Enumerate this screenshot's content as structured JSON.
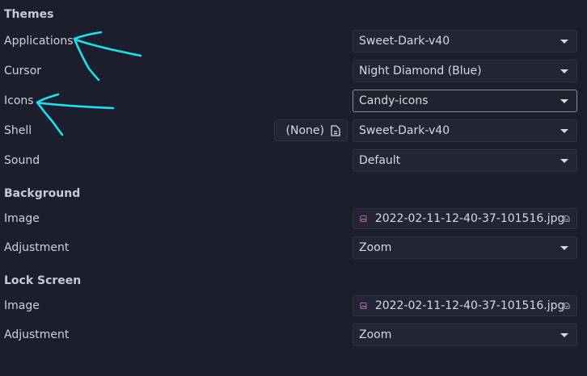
{
  "themes": {
    "title": "Themes",
    "applications": {
      "label": "Applications",
      "value": "Sweet-Dark-v40"
    },
    "cursor": {
      "label": "Cursor",
      "value": "Night Diamond (Blue)"
    },
    "icons": {
      "label": "Icons",
      "value": "Candy-icons"
    },
    "shell": {
      "label": "Shell",
      "value": "Sweet-Dark-v40",
      "file_button": "(None)"
    },
    "sound": {
      "label": "Sound",
      "value": "Default"
    }
  },
  "background": {
    "title": "Background",
    "image": {
      "label": "Image",
      "value": "2022-02-11-12-40-37-101516.jpg"
    },
    "adjustment": {
      "label": "Adjustment",
      "value": "Zoom"
    }
  },
  "lock_screen": {
    "title": "Lock Screen",
    "image": {
      "label": "Image",
      "value": "2022-02-11-12-40-37-101516.jpg"
    },
    "adjustment": {
      "label": "Adjustment",
      "value": "Zoom"
    }
  },
  "colors": {
    "background": "#1c1e2d",
    "annotation": "#19e3ee",
    "image_icon": "#c97fe0"
  },
  "icons": {
    "dropdown": "chevron-down-icon",
    "file": "document-icon",
    "image": "image-icon"
  }
}
